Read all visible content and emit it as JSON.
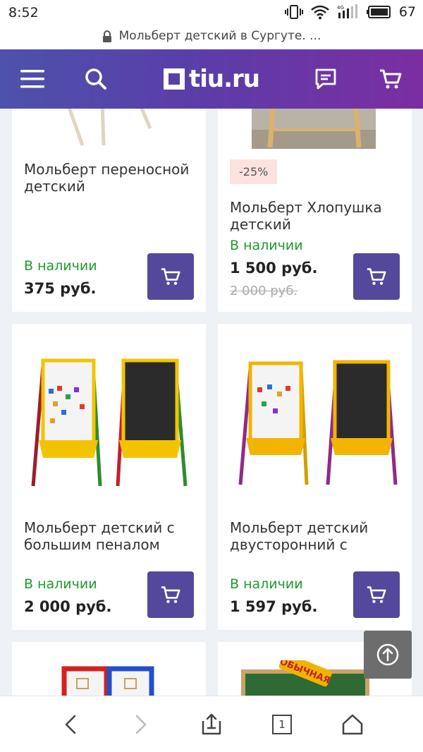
{
  "status_bar": {
    "time": "8:52",
    "battery": "67",
    "network": "4G"
  },
  "browser": {
    "url_title": "Мольберт детский в Сургуте. ..."
  },
  "site": {
    "logo_text": "tiu.ru"
  },
  "products": [
    {
      "title": "Мольберт переносной детский",
      "stock": "В наличии",
      "price": "375 руб."
    },
    {
      "title": "Мольберт Хлопушка детский",
      "discount": "-25%",
      "stock": "В наличии",
      "price": "1 500 руб.",
      "old_price": "2 000 руб."
    },
    {
      "title": "Мольберт детский с большим пеналом",
      "stock": "В наличии",
      "price": "2 000 руб."
    },
    {
      "title": "Мольберт детский двусторонний с",
      "stock": "В наличии",
      "price": "1 597 руб."
    },
    {
      "title": ""
    },
    {
      "title": "",
      "image_text": "ОБЫЧНАЯ"
    }
  ],
  "bottom_nav": {
    "tab_count": "1"
  },
  "colors": {
    "header_start": "#4d52ab",
    "header_end": "#7b2ea2",
    "cart_button": "#54489c",
    "in_stock": "#1e9b2c",
    "badge_bg": "#fde2e0"
  }
}
